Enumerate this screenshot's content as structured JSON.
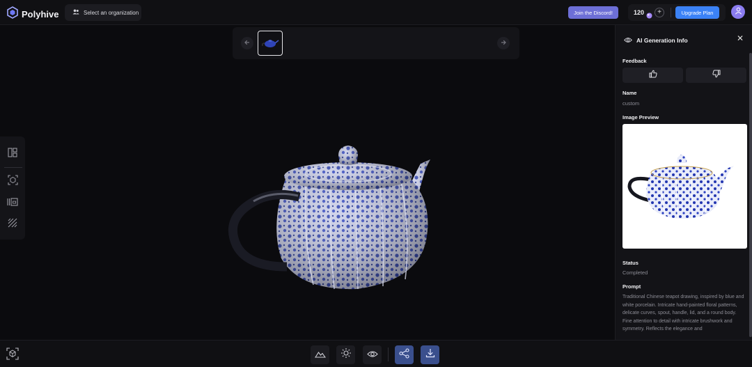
{
  "app": {
    "name": "Polyhive"
  },
  "header": {
    "org_button_label": "Select an organization",
    "discord_label": "Join the Discord!",
    "credits": "120",
    "plus_label": "+",
    "upgrade_label": "Upgrade Plan"
  },
  "panel": {
    "title": "AI Generation Info",
    "close_label": "✕",
    "feedback_label": "Feedback",
    "name_label": "Name",
    "name_value": "custom",
    "image_preview_label": "Image Preview",
    "status_label": "Status",
    "status_value": "Completed",
    "prompt_label": "Prompt",
    "prompt_value": "Traditional Chinese teapot drawing, inspired by blue and white porcelain. Intricate hand-painted floral patterns, delicate curves, spout, handle, lid, and a round body. Fine attention to detail with intricate brushwork and symmetry. Reflects the elegance and"
  },
  "icons": {
    "logo": "polyhive-logo-icon",
    "org": "users-icon",
    "gem": "gem-icon",
    "avatar": "user-icon",
    "eye": "eye-icon",
    "thumbs_up": "thumbs-up-icon",
    "thumbs_down": "thumbs-down-icon",
    "layout": "layout-panel-icon",
    "scan": "scan-object-icon",
    "frames": "frames-icon",
    "hatch": "hatch-pattern-icon",
    "mountain": "terrain-icon",
    "sun": "sun-icon",
    "share": "share-icon",
    "download": "download-icon",
    "cube": "cube-icon"
  },
  "colors": {
    "accent_blue": "#3b82f6",
    "discord": "#6d6fd6",
    "avatar": "#8b7cf0",
    "porcelain_blue": "#2a3fae"
  }
}
